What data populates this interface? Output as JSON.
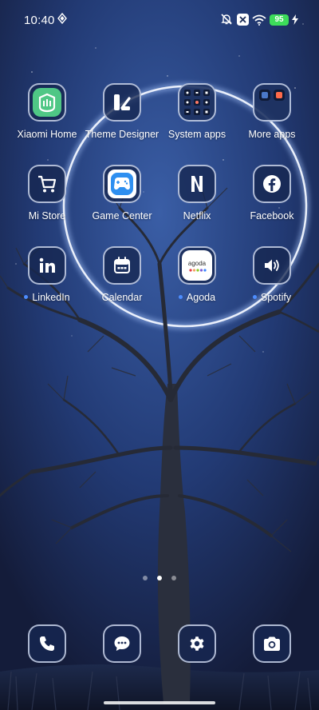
{
  "status_bar": {
    "time": "10:40",
    "battery_level": "95",
    "icons": [
      "nfc-icon",
      "silent-icon",
      "x-icon",
      "wifi-icon",
      "battery-icon",
      "charging-icon"
    ]
  },
  "apps": [
    {
      "label": "Xiaomi Home",
      "icon": "xiaomi-home-icon",
      "has_dot": false
    },
    {
      "label": "Theme Designer",
      "icon": "theme-designer-icon",
      "has_dot": false
    },
    {
      "label": "System apps",
      "icon": "system-apps-folder-icon",
      "has_dot": false
    },
    {
      "label": "More apps",
      "icon": "more-apps-folder-icon",
      "has_dot": false
    },
    {
      "label": "Mi Store",
      "icon": "cart-icon",
      "has_dot": false
    },
    {
      "label": "Game Center",
      "icon": "gamepad-icon",
      "has_dot": false
    },
    {
      "label": "Netflix",
      "icon": "netflix-icon",
      "has_dot": false
    },
    {
      "label": "Facebook",
      "icon": "facebook-icon",
      "has_dot": false
    },
    {
      "label": "LinkedIn",
      "icon": "linkedin-icon",
      "has_dot": true
    },
    {
      "label": "Calendar",
      "icon": "calendar-icon",
      "has_dot": false
    },
    {
      "label": "Agoda",
      "icon": "agoda-icon",
      "has_dot": true
    },
    {
      "label": "Spotify",
      "icon": "speaker-icon",
      "has_dot": true
    }
  ],
  "agoda_logo_text": "agoda",
  "page_indicator": {
    "pages": 3,
    "current": 2
  },
  "dock": [
    "phone-icon",
    "messages-icon",
    "settings-gear-icon",
    "camera-icon"
  ],
  "colors": {
    "accent_dot": "#4d8dff",
    "battery": "#3ddc5a"
  }
}
